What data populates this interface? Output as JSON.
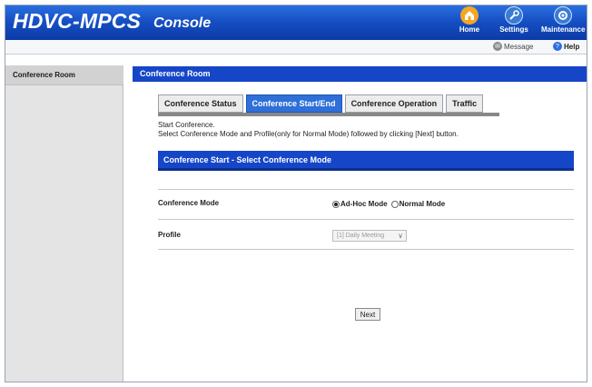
{
  "header": {
    "brand": "HDVC-MPCS",
    "console_label": "Console",
    "nav": [
      {
        "label": "Home",
        "icon": "home-icon",
        "color": "#f5a623"
      },
      {
        "label": "Settings",
        "icon": "wrench-icon",
        "color": "#3a7bd5"
      },
      {
        "label": "Maintenance",
        "icon": "maintenance-icon",
        "color": "#3a7bd5"
      }
    ],
    "subnav": {
      "message": "Message",
      "help": "Help"
    }
  },
  "sidebar": {
    "items": [
      {
        "label": "Conference Room"
      }
    ]
  },
  "main": {
    "title": "Conference Room",
    "tabs": [
      {
        "label": "Conference Status",
        "active": false
      },
      {
        "label": "Conference Start/End",
        "active": true
      },
      {
        "label": "Conference Operation",
        "active": false
      },
      {
        "label": "Traffic",
        "active": false
      }
    ],
    "description": {
      "line1": "Start Conference.",
      "line2": "Select Conference Mode and Profile(only for Normal Mode) followed by clicking [Next] button."
    },
    "section_title": "Conference Start - Select Conference Mode",
    "conference_mode": {
      "label": "Conference Mode",
      "options": [
        {
          "label": "Ad-Hoc Mode",
          "selected": true
        },
        {
          "label": "Normal Mode",
          "selected": false
        }
      ]
    },
    "profile": {
      "label": "Profile",
      "value": "[1] Daily Meeting"
    },
    "next_label": "Next"
  },
  "colors": {
    "header_blue": "#1650c4",
    "title_bar_blue": "#1646c8",
    "active_tab": "#2e6fd8"
  }
}
